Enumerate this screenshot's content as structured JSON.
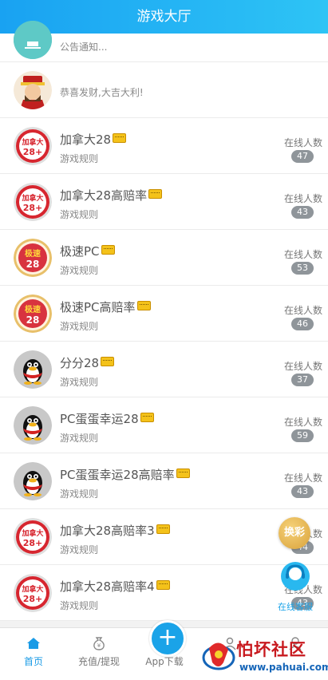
{
  "header": {
    "title": "游戏大厅"
  },
  "notice": {
    "text": "公告通知..."
  },
  "welcome": {
    "text": "恭喜发财,大吉大利!"
  },
  "online_label": "在线人数",
  "games": [
    {
      "name": "加拿大28",
      "sub": "游戏规则",
      "online": "47",
      "icon": "jianada-28-ball-icon"
    },
    {
      "name": "加拿大28高赔率",
      "sub": "游戏规则",
      "online": "43",
      "icon": "jianada-28-ball-icon"
    },
    {
      "name": "极速PC",
      "sub": "游戏规则",
      "online": "53",
      "icon": "jisu-28-ball-icon"
    },
    {
      "name": "极速PC高赔率",
      "sub": "游戏规则",
      "online": "46",
      "icon": "jisu-28-ball-icon"
    },
    {
      "name": "分分28",
      "sub": "游戏规则",
      "online": "37",
      "icon": "penguin-icon"
    },
    {
      "name": "PC蛋蛋幸运28",
      "sub": "游戏规则",
      "online": "59",
      "icon": "penguin-icon"
    },
    {
      "name": "PC蛋蛋幸运28高赔率",
      "sub": "游戏规则",
      "online": "43",
      "icon": "penguin-icon"
    },
    {
      "name": "加拿大28高赔率3",
      "sub": "游戏规则",
      "online": "44",
      "icon": "jianada-28-ball-icon"
    },
    {
      "name": "加拿大28高赔率4",
      "sub": "游戏规则",
      "online": "43",
      "icon": "jianada-28-ball-icon"
    }
  ],
  "ball_labels": {
    "jianada": "加拿大",
    "num": "28+",
    "jisu": "极速",
    "num2": "28"
  },
  "float": {
    "change": "换彩",
    "service": "在线客服"
  },
  "nav": {
    "home": "首页",
    "recharge": "充值/提现",
    "app": "App下载",
    "app_plus": "+"
  },
  "watermark": {
    "name": "怕坏社区",
    "url": "www.pahuai.com"
  },
  "colors": {
    "header": "#19a2f2",
    "accent": "#1a9be6",
    "badge": "#8f959a"
  }
}
